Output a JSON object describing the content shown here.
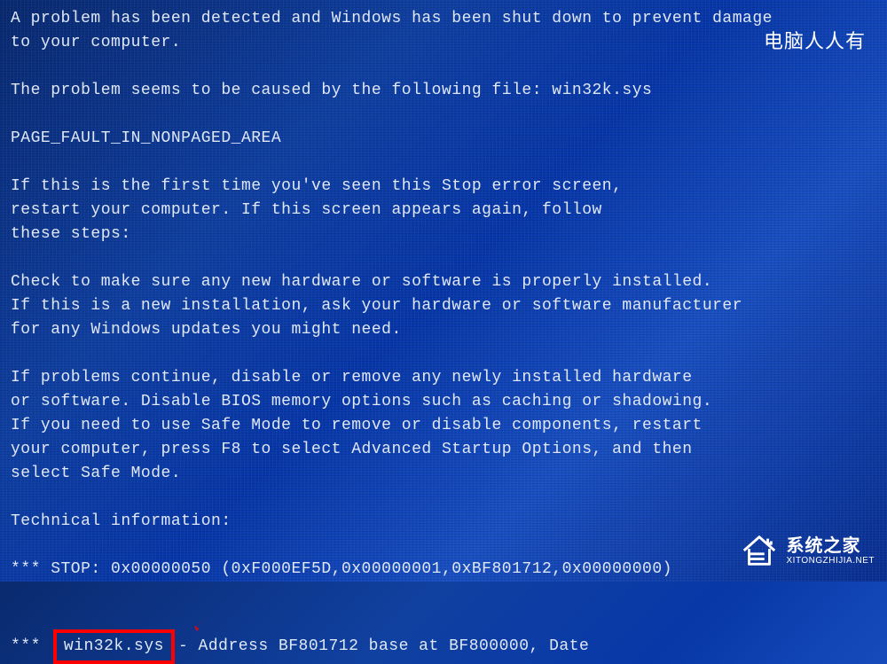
{
  "bsod": {
    "header_line1": "A problem has been detected and Windows has been shut down to prevent damage",
    "header_line2": "to your computer.",
    "cause_line": "The problem seems to be caused by the following file: win32k.sys",
    "error_code": "PAGE_FAULT_IN_NONPAGED_AREA",
    "first_time_line1": "If this is the first time you've seen this Stop error screen,",
    "first_time_line2": "restart your computer. If this screen appears again, follow",
    "first_time_line3": "these steps:",
    "check_line1": "Check to make sure any new hardware or software is properly installed.",
    "check_line2": "If this is a new installation, ask your hardware or software manufacturer",
    "check_line3": "for any Windows updates you might need.",
    "problems_line1": "If problems continue, disable or remove any newly installed hardware",
    "problems_line2": "or software. Disable BIOS memory options such as caching or shadowing.",
    "problems_line3": "If you need to use Safe Mode to remove or disable components, restart",
    "problems_line4": "your computer, press F8 to select Advanced Startup Options, and then",
    "problems_line5": "select Safe Mode.",
    "tech_header": "Technical information:",
    "stop_line": "*** STOP: 0x00000050 (0xF000EF5D,0x00000001,0xBF801712,0x00000000)",
    "driver_stars": "***",
    "driver_file": "win32k.sys",
    "driver_rest": " - Address BF801712 base at BF800000, Date"
  },
  "watermarks": {
    "top": "电脑人人有",
    "bottom_main": "系统之家",
    "bottom_sub": "XITONGZHIJIA.NET"
  }
}
